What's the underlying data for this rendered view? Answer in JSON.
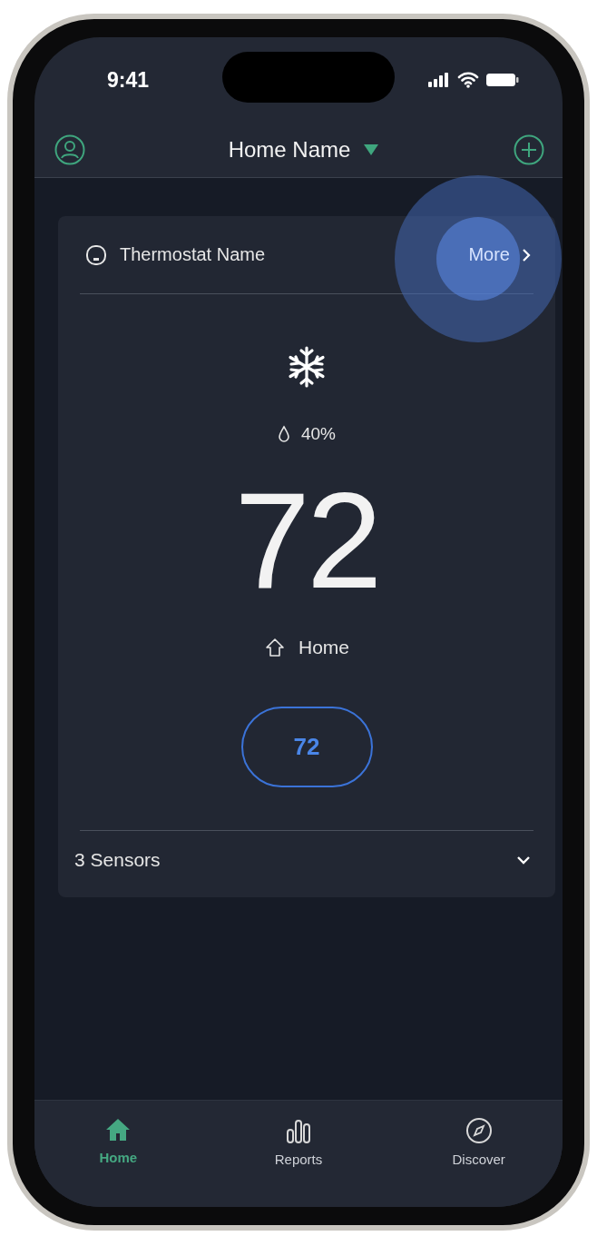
{
  "status_bar": {
    "time": "9:41"
  },
  "header": {
    "title": "Home Name"
  },
  "thermostat": {
    "name": "Thermostat Name",
    "more_label": "More",
    "more_pressed": true,
    "mode": {
      "kind": "cool"
    },
    "humidity": "40%",
    "temperature": "72",
    "comfort_setting": "Home",
    "setpoint": "72",
    "sensors": {
      "label": "3 Sensors",
      "expanded": false
    }
  },
  "tabs": [
    {
      "label": "Home",
      "kind": "home",
      "selected": true
    },
    {
      "label": "Reports",
      "kind": "reports",
      "selected": false
    },
    {
      "label": "Discover",
      "kind": "discover",
      "selected": false
    }
  ]
}
